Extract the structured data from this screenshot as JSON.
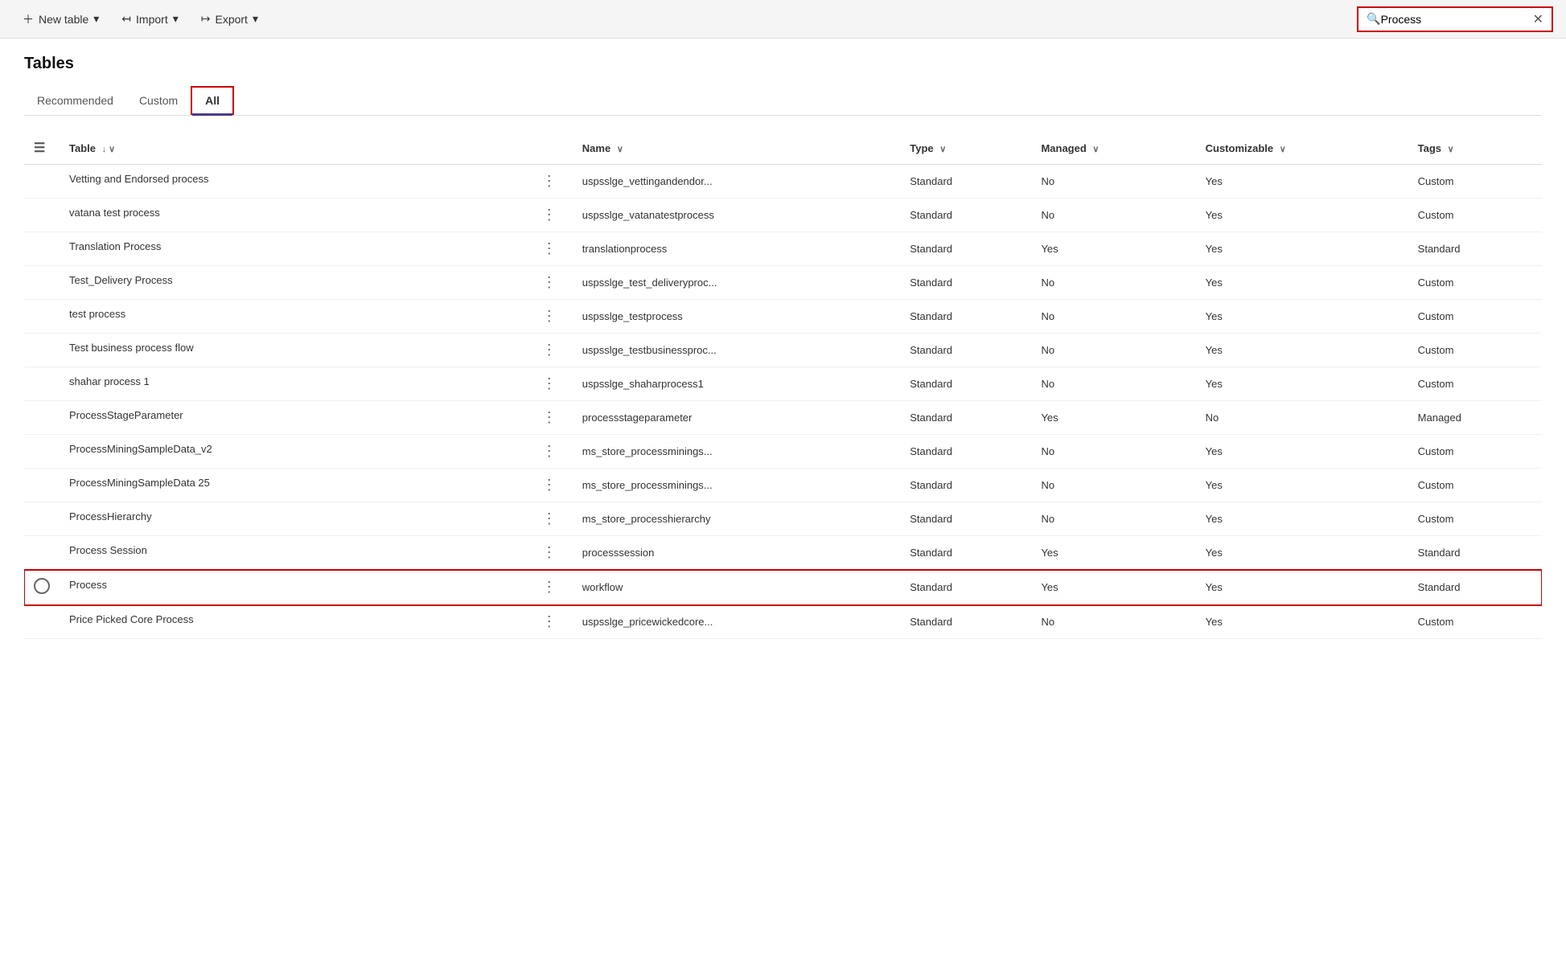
{
  "toolbar": {
    "new_table_label": "New table",
    "import_label": "Import",
    "export_label": "Export"
  },
  "search": {
    "placeholder": "Process",
    "value": "Process"
  },
  "page": {
    "title": "Tables"
  },
  "tabs": [
    {
      "id": "recommended",
      "label": "Recommended",
      "active": false
    },
    {
      "id": "custom",
      "label": "Custom",
      "active": false
    },
    {
      "id": "all",
      "label": "All",
      "active": true
    }
  ],
  "table": {
    "columns": [
      {
        "id": "table",
        "label": "Table",
        "sortable": true
      },
      {
        "id": "name",
        "label": "Name",
        "sortable": true
      },
      {
        "id": "type",
        "label": "Type",
        "sortable": true
      },
      {
        "id": "managed",
        "label": "Managed",
        "sortable": true
      },
      {
        "id": "customizable",
        "label": "Customizable",
        "sortable": true
      },
      {
        "id": "tags",
        "label": "Tags",
        "sortable": true
      }
    ],
    "rows": [
      {
        "table": "Vetting and Endorsed process",
        "name": "uspsslge_vettingandendor...",
        "type": "Standard",
        "managed": "No",
        "customizable": "Yes",
        "tags": "Custom",
        "highlighted": false
      },
      {
        "table": "vatana test process",
        "name": "uspsslge_vatanatestprocess",
        "type": "Standard",
        "managed": "No",
        "customizable": "Yes",
        "tags": "Custom",
        "highlighted": false
      },
      {
        "table": "Translation Process",
        "name": "translationprocess",
        "type": "Standard",
        "managed": "Yes",
        "customizable": "Yes",
        "tags": "Standard",
        "highlighted": false
      },
      {
        "table": "Test_Delivery Process",
        "name": "uspsslge_test_deliveryproc...",
        "type": "Standard",
        "managed": "No",
        "customizable": "Yes",
        "tags": "Custom",
        "highlighted": false
      },
      {
        "table": "test process",
        "name": "uspsslge_testprocess",
        "type": "Standard",
        "managed": "No",
        "customizable": "Yes",
        "tags": "Custom",
        "highlighted": false
      },
      {
        "table": "Test business process flow",
        "name": "uspsslge_testbusinessproc...",
        "type": "Standard",
        "managed": "No",
        "customizable": "Yes",
        "tags": "Custom",
        "highlighted": false
      },
      {
        "table": "shahar process 1",
        "name": "uspsslge_shaharprocess1",
        "type": "Standard",
        "managed": "No",
        "customizable": "Yes",
        "tags": "Custom",
        "highlighted": false
      },
      {
        "table": "ProcessStageParameter",
        "name": "processstageparameter",
        "type": "Standard",
        "managed": "Yes",
        "customizable": "No",
        "tags": "Managed",
        "highlighted": false
      },
      {
        "table": "ProcessMiningSampleData_v2",
        "name": "ms_store_processminings...",
        "type": "Standard",
        "managed": "No",
        "customizable": "Yes",
        "tags": "Custom",
        "highlighted": false
      },
      {
        "table": "ProcessMiningSampleData 25",
        "name": "ms_store_processminings...",
        "type": "Standard",
        "managed": "No",
        "customizable": "Yes",
        "tags": "Custom",
        "highlighted": false
      },
      {
        "table": "ProcessHierarchy",
        "name": "ms_store_processhierarchy",
        "type": "Standard",
        "managed": "No",
        "customizable": "Yes",
        "tags": "Custom",
        "highlighted": false
      },
      {
        "table": "Process Session",
        "name": "processsession",
        "type": "Standard",
        "managed": "Yes",
        "customizable": "Yes",
        "tags": "Standard",
        "highlighted": false
      },
      {
        "table": "Process",
        "name": "workflow",
        "type": "Standard",
        "managed": "Yes",
        "customizable": "Yes",
        "tags": "Standard",
        "highlighted": true
      },
      {
        "table": "Price Picked Core Process",
        "name": "uspsslge_pricewickedcore...",
        "type": "Standard",
        "managed": "No",
        "customizable": "Yes",
        "tags": "Custom",
        "highlighted": false
      }
    ]
  }
}
